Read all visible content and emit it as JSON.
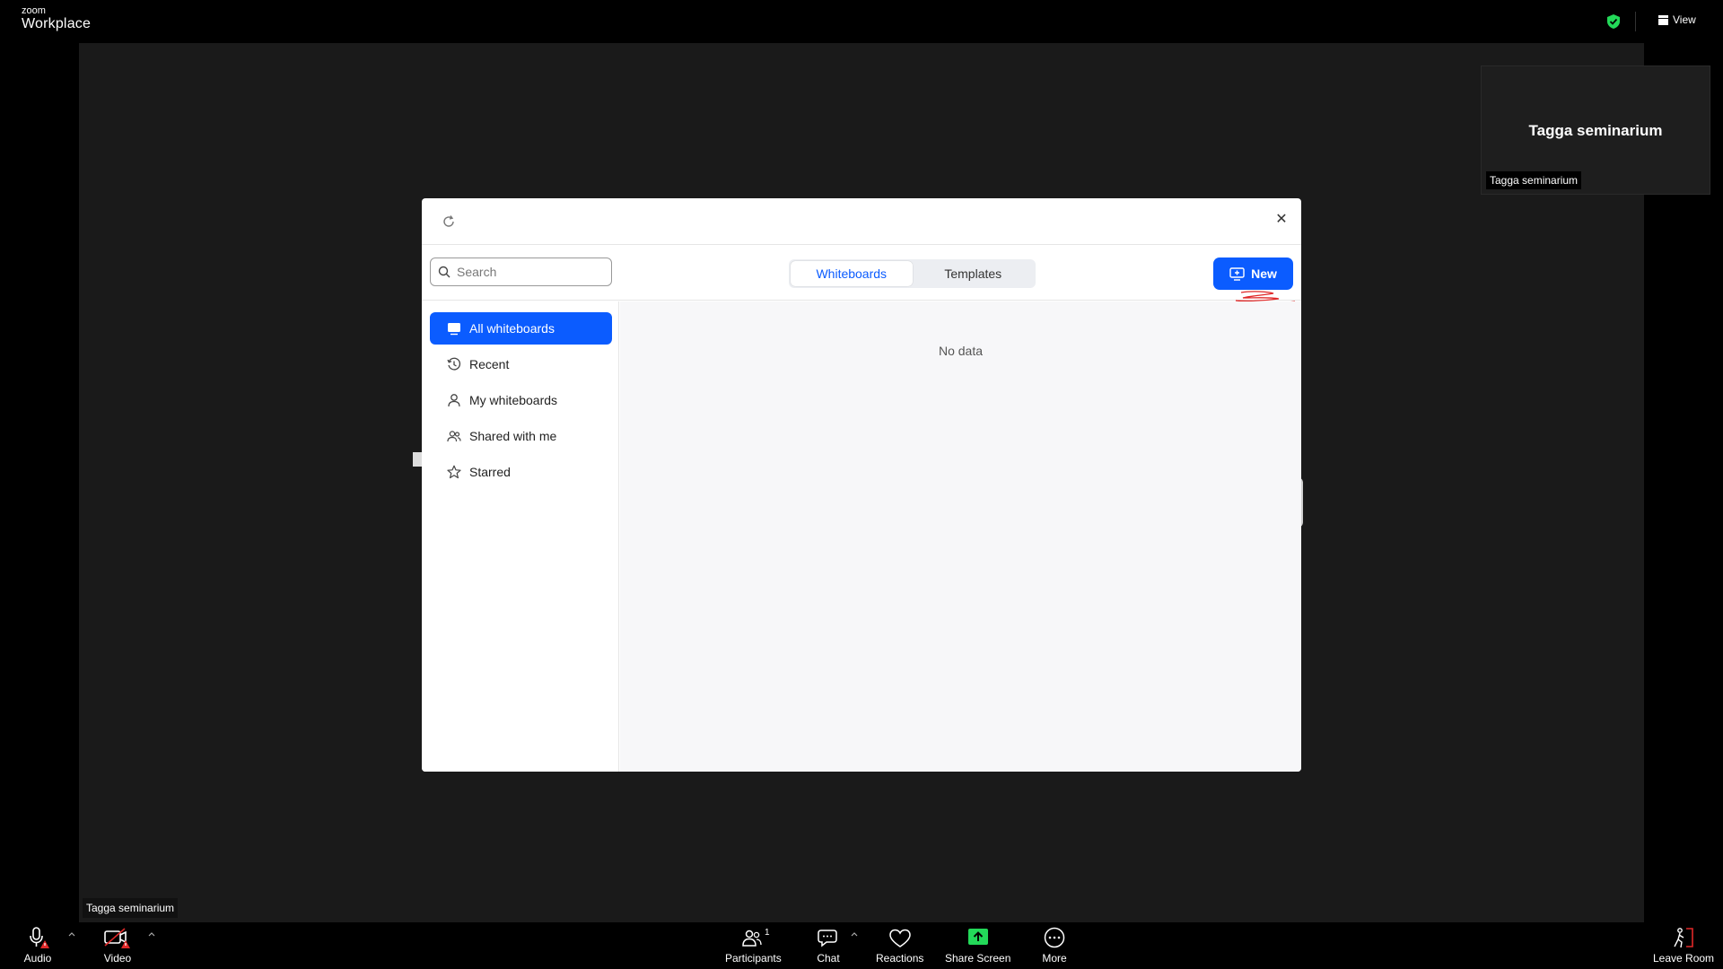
{
  "app": {
    "brand_small": "zoom",
    "brand_big": "Workplace"
  },
  "topbar": {
    "view_label": "View",
    "shield_color": "#23d959"
  },
  "participant": {
    "name_big": "Tagga seminarium",
    "name_label": "Tagga seminarium",
    "self_label": "Tagga seminarium"
  },
  "modal": {
    "search_placeholder": "Search",
    "tabs": [
      {
        "label": "Whiteboards",
        "active": true
      },
      {
        "label": "Templates",
        "active": false
      }
    ],
    "new_button": "New",
    "sidebar": [
      {
        "label": "All whiteboards",
        "icon": "whiteboard-icon",
        "active": true
      },
      {
        "label": "Recent",
        "icon": "clock-icon"
      },
      {
        "label": "My whiteboards",
        "icon": "user-icon"
      },
      {
        "label": "Shared with me",
        "icon": "users-icon"
      },
      {
        "label": "Starred",
        "icon": "star-icon"
      }
    ],
    "empty_text": "No data",
    "accent": "#0b5cff"
  },
  "bottombar": {
    "audio": "Audio",
    "video": "Video",
    "participants": "Participants",
    "participants_count": "1",
    "chat": "Chat",
    "reactions": "Reactions",
    "share_screen": "Share Screen",
    "more": "More",
    "leave": "Leave Room",
    "warning_color": "#e02828",
    "share_color": "#23d959"
  }
}
